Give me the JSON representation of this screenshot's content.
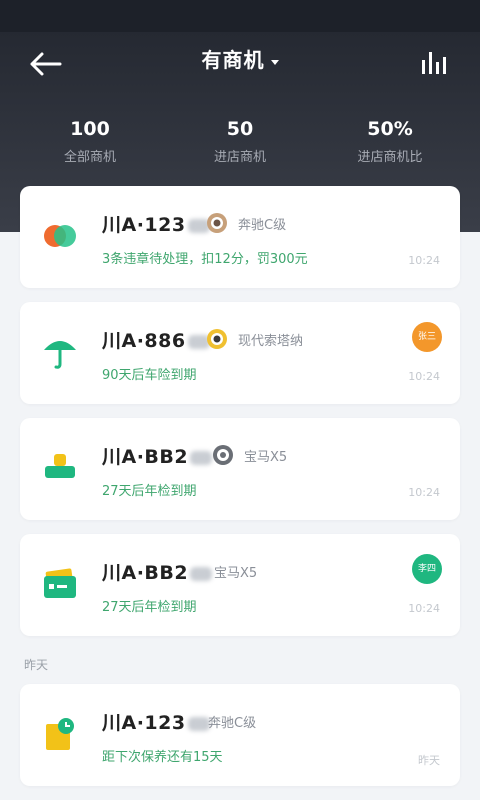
{
  "header": {
    "title": "有商机"
  },
  "stats": [
    {
      "value": "100",
      "label": "全部商机"
    },
    {
      "value": "50",
      "label": "进店商机"
    },
    {
      "value": "50%",
      "label": "进店商机比"
    }
  ],
  "cards": [
    {
      "plate": "川A·123",
      "brand": "奔驰C级",
      "desc": "3条违章待处理，扣12分，罚300元",
      "time": "10:24",
      "icon": "violation-circles-icon",
      "brand_icon": "benz-logo-icon"
    },
    {
      "plate": "川A·886",
      "brand": "现代索塔纳",
      "desc": "90天后车险到期",
      "time": "10:24",
      "icon": "umbrella-icon",
      "brand_icon": "hyundai-logo-icon",
      "assignee": "张三",
      "assignee_color": "#f3972b"
    },
    {
      "plate": "川A·BB2",
      "brand": "宝马X5",
      "desc": "27天后年检到期",
      "time": "10:24",
      "icon": "stamp-icon",
      "brand_icon": "bmw-logo-icon"
    },
    {
      "plate": "川A·BB2",
      "brand": "宝马X5",
      "desc": "27天后年检到期",
      "time": "10:24",
      "icon": "wallet-card-icon",
      "assignee": "李四",
      "assignee_color": "#1fb780"
    },
    {
      "plate": "川A·123",
      "brand": "奔驰C级",
      "desc": "距下次保养还有15天",
      "time": "昨天",
      "icon": "maintenance-clock-icon"
    }
  ],
  "section_label": "昨天",
  "colors": {
    "header_bg": "#2b2f38",
    "accent_green": "#1fb780",
    "accent_orange": "#f3972b",
    "desc_green": "#3fa66e"
  }
}
